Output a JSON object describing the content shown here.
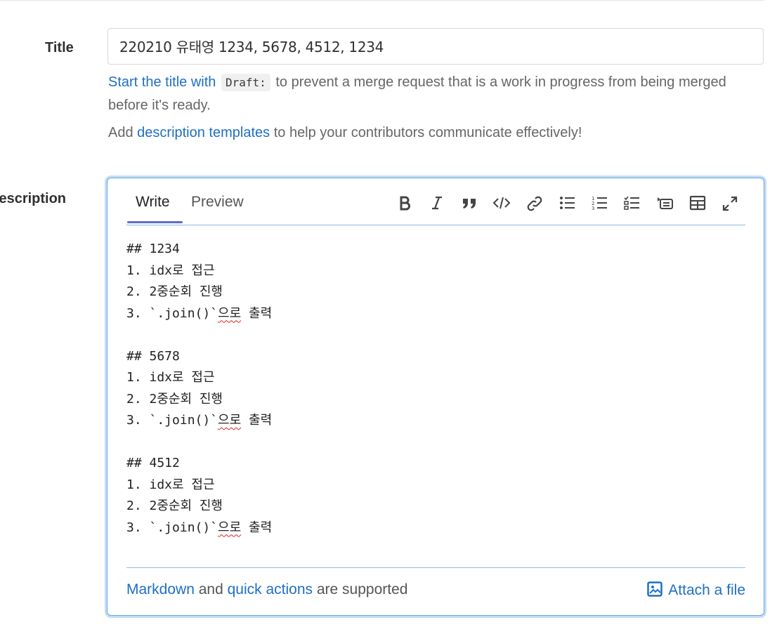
{
  "form": {
    "title_label": "Title",
    "title_value": "220210 유태영 1234, 5678, 4512, 1234",
    "hint_pre": "Start the title with",
    "hint_code": "Draft:",
    "hint_post": "to prevent a merge request that is a work in progress from being merged before it's ready.",
    "templates_pre": "Add",
    "templates_link": "description templates",
    "templates_post": "to help your contributors communicate effectively!",
    "description_label": "Description"
  },
  "editor": {
    "tabs": [
      {
        "label": "Write",
        "active": true
      },
      {
        "label": "Preview",
        "active": false
      }
    ],
    "toolbar": [
      "bold-icon",
      "italic-icon",
      "quote-icon",
      "code-icon",
      "link-icon",
      "bullet-list-icon",
      "numbered-list-icon",
      "task-list-icon",
      "collapsible-icon",
      "table-icon",
      "fullscreen-icon"
    ],
    "lines": [
      "## 1234",
      "1. idx로 접근",
      "2. 2중순회 진행",
      "3. `.join()`으로 출력",
      "",
      "## 5678",
      "1. idx로 접근",
      "2. 2중순회 진행",
      "3. `.join()`으로 출력",
      "",
      "## 4512",
      "1. idx로 접근",
      "2. 2중순회 진행",
      "3. `.join()`으로 출력"
    ],
    "footer_link1": "Markdown",
    "footer_and": "and",
    "footer_link2": "quick actions",
    "footer_post": "are supported",
    "attach_label": "Attach a file"
  },
  "colors": {
    "link": "#1f6fc4",
    "focus_border": "#6aa6df",
    "tab_underline": "#5b6cc8"
  }
}
